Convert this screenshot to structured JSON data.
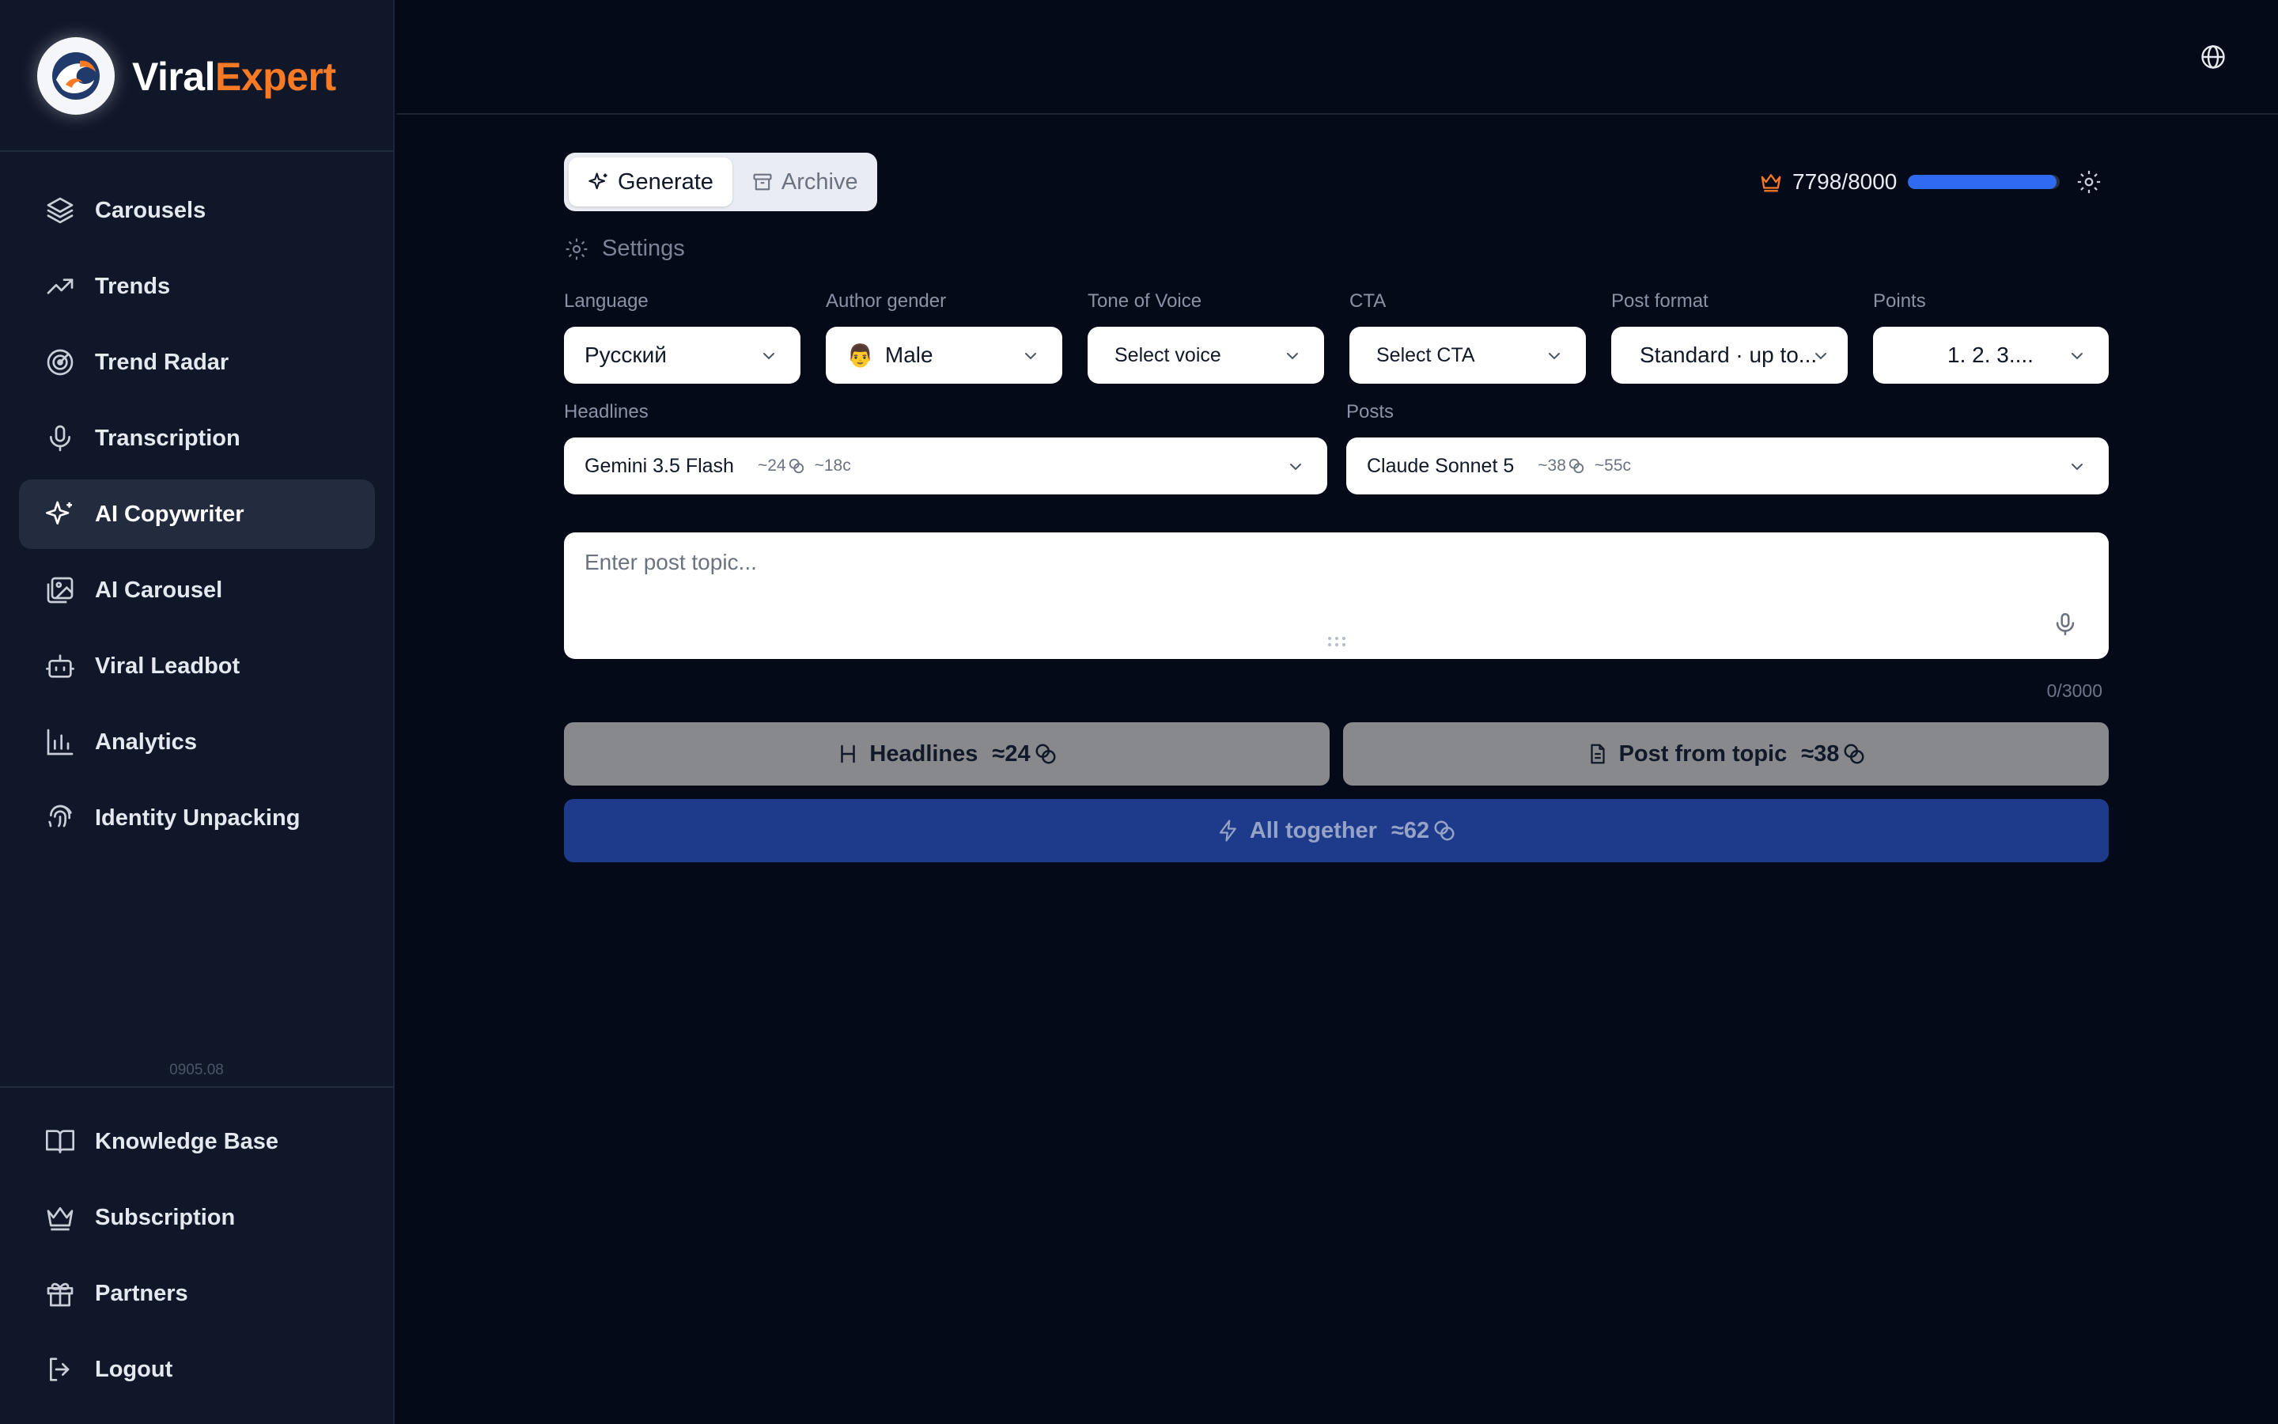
{
  "app": {
    "brand_part1": "Viral",
    "brand_part2": "Expert",
    "version": "0905.08",
    "accent_color": "#f97a24",
    "primary_color": "#1e3a8a"
  },
  "sidebar": {
    "items": [
      {
        "label": "Carousels",
        "icon": "layers-icon"
      },
      {
        "label": "Trends",
        "icon": "trending-up-icon"
      },
      {
        "label": "Trend Radar",
        "icon": "radar-icon"
      },
      {
        "label": "Transcription",
        "icon": "microphone-icon"
      },
      {
        "label": "AI Copywriter",
        "icon": "sparkles-icon",
        "active": true
      },
      {
        "label": "AI Carousel",
        "icon": "images-icon"
      },
      {
        "label": "Viral Leadbot",
        "icon": "bot-icon"
      },
      {
        "label": "Analytics",
        "icon": "bar-chart-icon"
      },
      {
        "label": "Identity Unpacking",
        "icon": "fingerprint-icon"
      }
    ],
    "bottom_items": [
      {
        "label": "Knowledge Base",
        "icon": "book-icon"
      },
      {
        "label": "Subscription",
        "icon": "crown-icon"
      },
      {
        "label": "Partners",
        "icon": "gift-icon"
      },
      {
        "label": "Logout",
        "icon": "logout-icon"
      }
    ]
  },
  "main": {
    "tabs": [
      {
        "label": "Generate",
        "active": true
      },
      {
        "label": "Archive",
        "active": false
      }
    ],
    "usage": {
      "text": "7798/8000",
      "used": 7798,
      "limit": 8000
    },
    "settings_label": "Settings",
    "fields": {
      "language": {
        "label": "Language",
        "value": "Русский"
      },
      "author_gender": {
        "label": "Author gender",
        "emoji": "👨",
        "value": "Male"
      },
      "tone": {
        "label": "Tone of Voice",
        "value": "Select voice"
      },
      "cta": {
        "label": "CTA",
        "value": "Select CTA"
      },
      "post_format": {
        "label": "Post format",
        "value": "Standard · up to..."
      },
      "points": {
        "label": "Points",
        "value": "1. 2. 3...."
      }
    },
    "models": {
      "headlines": {
        "label": "Headlines",
        "value": "Gemini 3.5 Flash",
        "cost1": "~24",
        "cost2": "~18c"
      },
      "posts": {
        "label": "Posts",
        "value": "Claude Sonnet 5",
        "cost1": "~38",
        "cost2": "~55c"
      }
    },
    "topic": {
      "placeholder": "Enter post topic...",
      "counter": "0/3000"
    },
    "buttons": {
      "headlines": {
        "label": "Headlines",
        "cost": "≈24"
      },
      "post_from_topic": {
        "label": "Post from topic",
        "cost": "≈38"
      },
      "all_together": {
        "label": "All together",
        "cost": "≈62"
      }
    }
  }
}
